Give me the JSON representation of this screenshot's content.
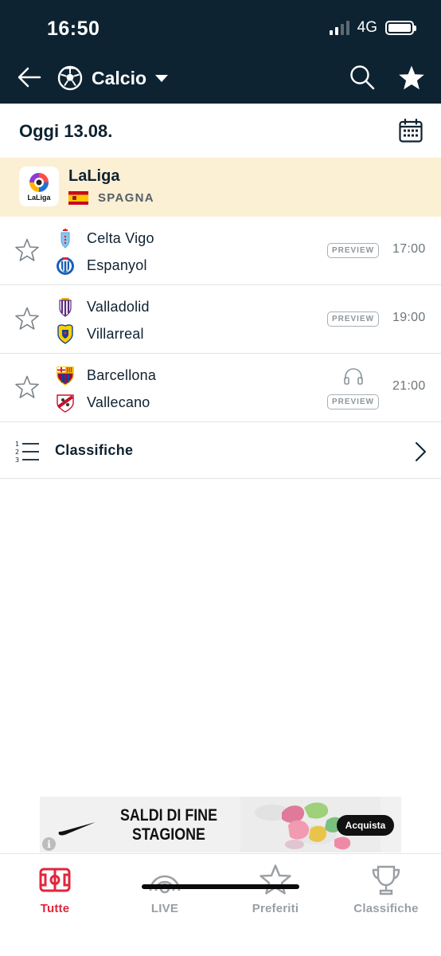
{
  "status_bar": {
    "time": "16:50",
    "network": "4G"
  },
  "nav": {
    "sport_label": "Calcio"
  },
  "date_label": "Oggi 13.08.",
  "league": {
    "name": "LaLiga",
    "logo_text": "LaLiga",
    "country": "SPAGNA"
  },
  "matches": [
    {
      "home": "Celta Vigo",
      "away": "Espanyol",
      "time": "17:00",
      "badge": "PREVIEW",
      "audio": false
    },
    {
      "home": "Valladolid",
      "away": "Villarreal",
      "time": "19:00",
      "badge": "PREVIEW",
      "audio": false
    },
    {
      "home": "Barcellona",
      "away": "Vallecano",
      "time": "21:00",
      "badge": "PREVIEW",
      "audio": true
    }
  ],
  "standings": {
    "label": "Classifiche",
    "icon_digits": [
      "1",
      "2",
      "3"
    ]
  },
  "ad": {
    "headline_1": "SALDI DI FINE",
    "headline_2": "STAGIONE",
    "cta": "Acquista",
    "info": "i"
  },
  "tabs": [
    {
      "label": "Tutte",
      "icon": "pitch-icon",
      "active": true
    },
    {
      "label": "LIVE",
      "icon": "live-icon",
      "active": false
    },
    {
      "label": "Preferiti",
      "icon": "star-icon",
      "active": false
    },
    {
      "label": "Classifiche",
      "icon": "trophy-icon",
      "active": false
    }
  ],
  "colors": {
    "header_bg": "#0e2331",
    "league_bg": "#fbefd4",
    "active_tab": "#e0263d",
    "inactive_tab": "#9a9fa4"
  }
}
